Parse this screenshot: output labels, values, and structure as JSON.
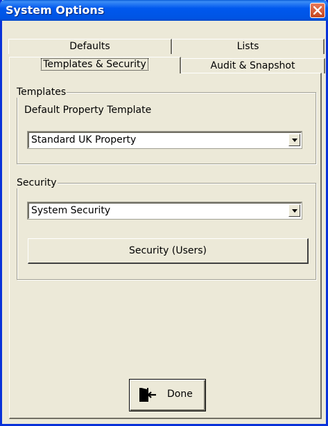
{
  "window": {
    "title": "System Options",
    "close_icon": "close-icon",
    "title_bar_color": "#0054e3"
  },
  "tabs": {
    "row1": [
      {
        "label": "Defaults"
      },
      {
        "label": "Lists"
      }
    ],
    "row2": [
      {
        "label": "Templates & Security",
        "active": true
      },
      {
        "label": "Audit & Snapshot"
      }
    ]
  },
  "templates": {
    "group_label": "Templates",
    "field_label": "Default Property Template",
    "selected_value": "Standard UK Property"
  },
  "security": {
    "group_label": "Security",
    "selected_value": "System Security",
    "users_button_label": "Security (Users)"
  },
  "footer": {
    "done_label": "Done",
    "done_icon": "exit-door-icon"
  }
}
